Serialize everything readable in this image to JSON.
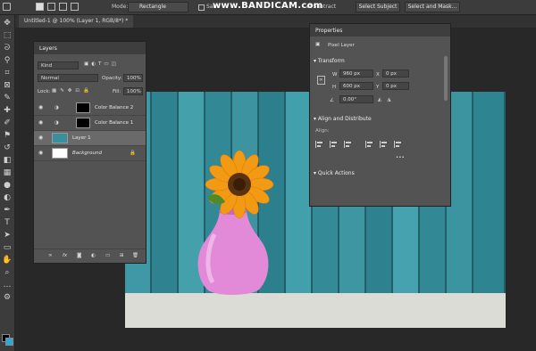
{
  "options_bar": {
    "mode_label": "Mode:",
    "mode_value": "Rectangle",
    "sample_partial": "Sam",
    "subtract_partial": "ct Subtract",
    "select_subject": "Select Subject",
    "select_and_mask": "Select and Mask..."
  },
  "watermark": "www.BANDICAM.com",
  "document": {
    "tab_title": "Untitled-1 @ 100% (Layer 1, RGB/8*) *"
  },
  "layers_panel": {
    "title": "Layers",
    "filter_kind": "Kind",
    "blend_mode": "Normal",
    "opacity_label": "Opacity:",
    "opacity_value": "100%",
    "lock_label": "Lock:",
    "fill_label": "Fill:",
    "fill_value": "100%",
    "layers": [
      {
        "name": "Color Balance 2"
      },
      {
        "name": "Color Balance 1"
      },
      {
        "name": "Layer 1"
      },
      {
        "name": "Background"
      }
    ],
    "footer_icons": [
      "link-icon",
      "fx-icon",
      "mask-icon",
      "adjustment-icon",
      "folder-icon",
      "new-layer-icon",
      "trash-icon"
    ]
  },
  "properties_panel": {
    "title": "Properties",
    "layer_type": "Pixel Layer",
    "transform_title": "Transform",
    "w_label": "W",
    "w_value": "960 px",
    "x_label": "X",
    "x_value": "0 px",
    "h_label": "H",
    "h_value": "600 px",
    "y_label": "Y",
    "y_value": "0 px",
    "angle_value": "0.00°",
    "align_title": "Align and Distribute",
    "align_label": "Align:",
    "more": "•••",
    "quick_actions_title": "Quick Actions"
  },
  "colors": {
    "foreground": "#000000",
    "background": "#2aa8e0",
    "panel_bg": "#535353",
    "selected_layer": "#6a6a6a",
    "wood_teal": "#3a8f9c",
    "vase_pink": "#e28ad8",
    "flower_orange": "#f29a14"
  }
}
